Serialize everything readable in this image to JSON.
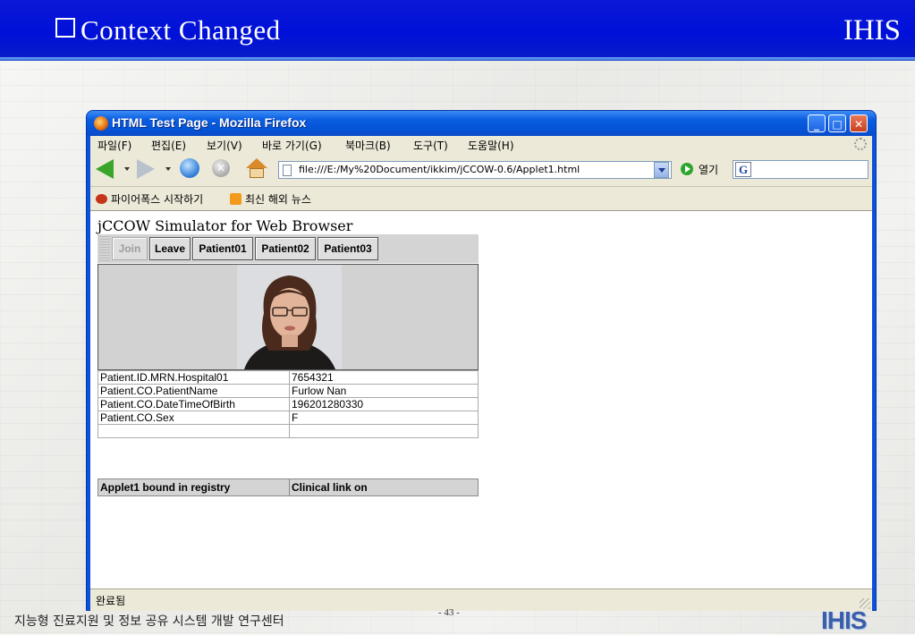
{
  "slide": {
    "title": "Context Changed",
    "brand": "IHIS",
    "footer_text": "지능형 진료지원 및 정보 공유 시스템 개발 연구센터",
    "page_number": "- 43 -",
    "footer_logo": "IHIS"
  },
  "browser": {
    "window_title": "HTML Test Page - Mozilla Firefox",
    "menu": [
      "파일(F)",
      "편집(E)",
      "보기(V)",
      "바로 가기(G)",
      "북마크(B)",
      "도구(T)",
      "도움말(H)"
    ],
    "address": "file:///E:/My%20Document/ikkim/jCCOW-0.6/Applet1.html",
    "go_label": "열기",
    "search_engine_icon": "G",
    "bookmarks": [
      "파이어폭스 시작하기",
      "최신 해외 뉴스"
    ],
    "status": "완료됨"
  },
  "applet": {
    "title": "jCCOW Simulator for Web Browser",
    "buttons": {
      "join": "Join",
      "leave": "Leave",
      "patient01": "Patient01",
      "patient02": "Patient02",
      "patient03": "Patient03"
    },
    "rows": [
      {
        "key": "Patient.ID.MRN.Hospital01",
        "value": "7654321"
      },
      {
        "key": "Patient.CO.PatientName",
        "value": "Furlow Nan"
      },
      {
        "key": "Patient.CO.DateTimeOfBirth",
        "value": "196201280330"
      },
      {
        "key": "Patient.CO.Sex",
        "value": "F"
      },
      {
        "key": "",
        "value": ""
      }
    ],
    "status_left": "Applet1 bound in registry",
    "status_right": "Clinical link on"
  },
  "colors": {
    "slide_header": "#0010d8",
    "titlebar": "#0554d8",
    "chrome": "#ece9d8"
  }
}
